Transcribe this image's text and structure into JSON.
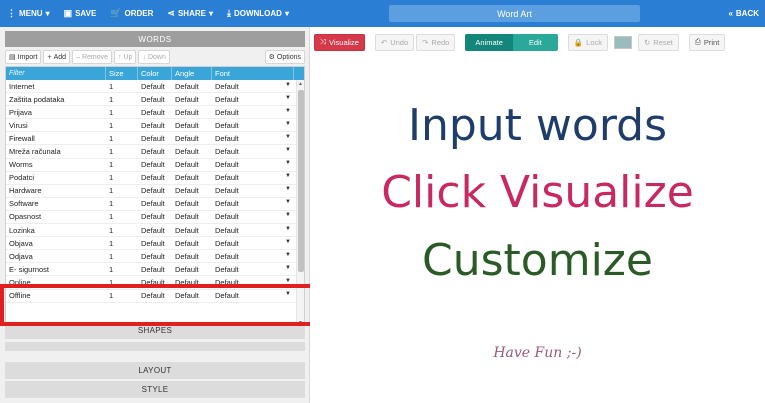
{
  "topbar": {
    "menu_label": "MENU",
    "save_label": "SAVE",
    "order_label": "ORDER",
    "share_label": "SHARE",
    "download_label": "DOWNLOAD",
    "title_value": "Word Art",
    "back_label": "BACK"
  },
  "words": {
    "header": "WORDS",
    "toolbar": {
      "import": "Import",
      "add": "Add",
      "remove": "Remove",
      "up": "Up",
      "down": "Down",
      "options": "Options"
    },
    "columns": {
      "filter_placeholder": "Filter",
      "size": "Size",
      "color": "Color",
      "angle": "Angle",
      "font": "Font"
    },
    "rows": [
      {
        "word": "Internet",
        "size": "1",
        "color": "Default",
        "angle": "Default",
        "font": "Default"
      },
      {
        "word": "Zaštita podataka",
        "size": "1",
        "color": "Default",
        "angle": "Default",
        "font": "Default"
      },
      {
        "word": "Prijava",
        "size": "1",
        "color": "Default",
        "angle": "Default",
        "font": "Default"
      },
      {
        "word": "Virusi",
        "size": "1",
        "color": "Default",
        "angle": "Default",
        "font": "Default"
      },
      {
        "word": "Firewall",
        "size": "1",
        "color": "Default",
        "angle": "Default",
        "font": "Default"
      },
      {
        "word": "Mreža računala",
        "size": "1",
        "color": "Default",
        "angle": "Default",
        "font": "Default"
      },
      {
        "word": "Worms",
        "size": "1",
        "color": "Default",
        "angle": "Default",
        "font": "Default"
      },
      {
        "word": "Podatci",
        "size": "1",
        "color": "Default",
        "angle": "Default",
        "font": "Default"
      },
      {
        "word": "Hardware",
        "size": "1",
        "color": "Default",
        "angle": "Default",
        "font": "Default"
      },
      {
        "word": "Software",
        "size": "1",
        "color": "Default",
        "angle": "Default",
        "font": "Default"
      },
      {
        "word": "Opasnost",
        "size": "1",
        "color": "Default",
        "angle": "Default",
        "font": "Default"
      },
      {
        "word": "Lozinka",
        "size": "1",
        "color": "Default",
        "angle": "Default",
        "font": "Default"
      },
      {
        "word": "Objava",
        "size": "1",
        "color": "Default",
        "angle": "Default",
        "font": "Default"
      },
      {
        "word": "Odjava",
        "size": "1",
        "color": "Default",
        "angle": "Default",
        "font": "Default"
      },
      {
        "word": "E- sigurnost",
        "size": "1",
        "color": "Default",
        "angle": "Default",
        "font": "Default"
      },
      {
        "word": "Online",
        "size": "1",
        "color": "Default",
        "angle": "Default",
        "font": "Default"
      },
      {
        "word": "Offline",
        "size": "1",
        "color": "Default",
        "angle": "Default",
        "font": "Default"
      }
    ]
  },
  "sections": {
    "shapes": "SHAPES",
    "layout": "LAYOUT",
    "style": "STYLE"
  },
  "toolbar": {
    "visualize": "Visualize",
    "undo": "Undo",
    "redo": "Redo",
    "animate": "Animate",
    "edit": "Edit",
    "lock": "Lock",
    "reset": "Reset",
    "print": "Print"
  },
  "canvas": {
    "line1": "Input words",
    "line2": "Click Visualize",
    "line3": "Customize",
    "line4": "Have Fun ;-)"
  },
  "colors": {
    "topbar": "#2a7fd4",
    "visualize": "#d63a4a",
    "animate": "#14857a",
    "line1": "#1e3d6b",
    "line2": "#c72a63",
    "line3": "#2a5a26",
    "highlight": "#e02020"
  }
}
